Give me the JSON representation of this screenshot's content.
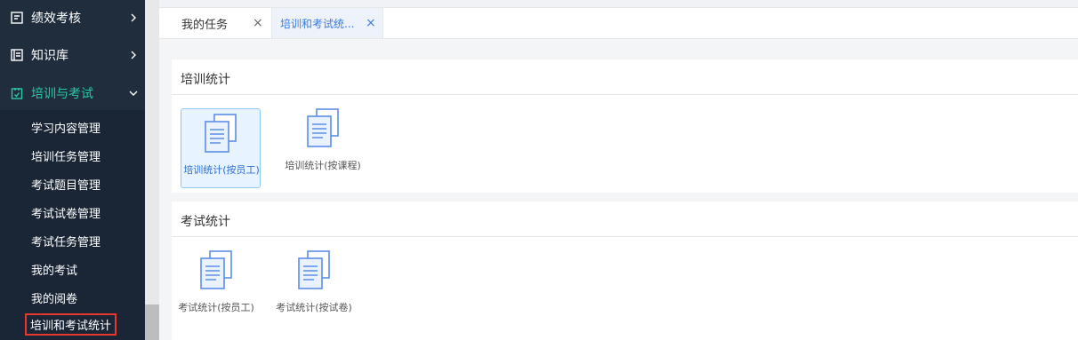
{
  "sidebar": {
    "menus": [
      {
        "label": "绩效考核",
        "icon": "performance-icon",
        "expanded": false
      },
      {
        "label": "知识库",
        "icon": "book-icon",
        "expanded": false
      },
      {
        "label": "培训与考试",
        "icon": "training-icon",
        "expanded": true
      }
    ],
    "subitems": [
      {
        "label": "学习内容管理"
      },
      {
        "label": "培训任务管理"
      },
      {
        "label": "考试题目管理"
      },
      {
        "label": "考试试卷管理"
      },
      {
        "label": "考试任务管理"
      },
      {
        "label": "我的考试"
      },
      {
        "label": "我的阅卷"
      },
      {
        "label": "培训和考试统计"
      }
    ]
  },
  "tabs": [
    {
      "label": "我的任务",
      "close": "×"
    },
    {
      "label": "培训和考试统...",
      "close": "×"
    }
  ],
  "sections": [
    {
      "title": "培训统计",
      "tiles": [
        {
          "label": "培训统计(按员工)",
          "icon": "document-stack-icon"
        },
        {
          "label": "培训统计(按课程)",
          "icon": "document-stack-icon"
        }
      ]
    },
    {
      "title": "考试统计",
      "tiles": [
        {
          "label": "考试统计(按员工)",
          "icon": "document-stack-icon"
        },
        {
          "label": "考试统计(按试卷)",
          "icon": "document-stack-icon"
        }
      ]
    }
  ],
  "colors": {
    "sidebar_bg": "#1f2d3d",
    "active_menu": "#29c7a8",
    "selected_border": "#e8372f",
    "tab_active": "#3a7ce0",
    "tile_highlight": "#e7f4ff"
  }
}
